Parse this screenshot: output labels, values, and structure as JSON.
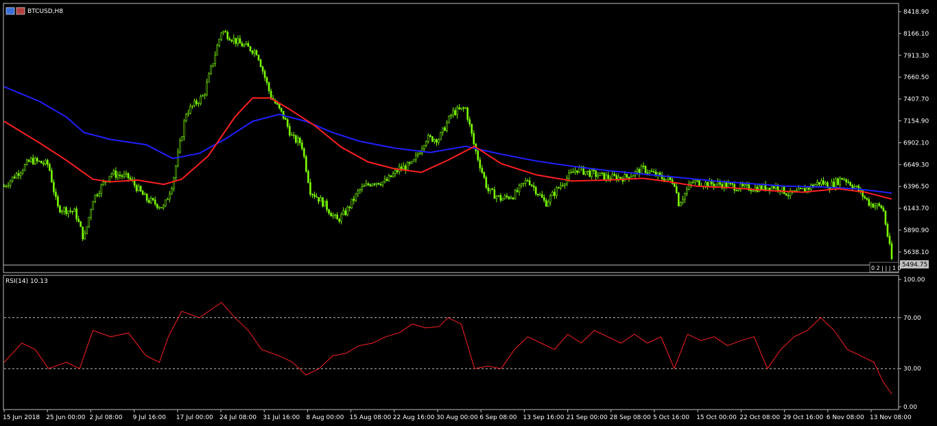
{
  "chart_data": [
    {
      "type": "candlestick",
      "title": "BTCUSD,H8",
      "symbol": "BTCUSD",
      "timeframe": "H8",
      "ylim": [
        5494.75,
        8418.9
      ],
      "y_ticks": [
        "8418.90",
        "8166.10",
        "7913.30",
        "7660.50",
        "7407.70",
        "7154.90",
        "6902.10",
        "6649.30",
        "6396.50",
        "6143.70",
        "5890.90",
        "5638.10"
      ],
      "current_price": "5494.75",
      "grid": false,
      "colors": {
        "background": "#000000",
        "candle": "#7CFC00",
        "ma_fast": "#ff2020",
        "ma_slow": "#2020ff",
        "axis": "#c0c0c0"
      },
      "x_tick_labels": [
        "15 Jun 2018",
        "25 Jun 00:00",
        "2 Jul 08:00",
        "9 Jul 16:00",
        "17 Jul 00:00",
        "24 Jul 08:00",
        "31 Jul 16:00",
        "8 Aug 00:00",
        "15 Aug 08:00",
        "22 Aug 16:00",
        "30 Aug 00:00",
        "6 Sep 08:00",
        "13 Sep 16:00",
        "21 Sep 00:00",
        "28 Sep 08:00",
        "5 Oct 16:00",
        "15 Oct 00:00",
        "22 Oct 08:00",
        "29 Oct 16:00",
        "6 Nov 08:00",
        "13 Nov 08:00"
      ],
      "close_path": [
        [
          0,
          6400
        ],
        [
          0.03,
          6700
        ],
        [
          0.05,
          6650
        ],
        [
          0.06,
          6150
        ],
        [
          0.08,
          6100
        ],
        [
          0.09,
          5780
        ],
        [
          0.1,
          6250
        ],
        [
          0.12,
          6550
        ],
        [
          0.14,
          6500
        ],
        [
          0.16,
          6250
        ],
        [
          0.18,
          6150
        ],
        [
          0.19,
          6450
        ],
        [
          0.205,
          7250
        ],
        [
          0.225,
          7450
        ],
        [
          0.245,
          8200
        ],
        [
          0.265,
          8050
        ],
        [
          0.285,
          7950
        ],
        [
          0.3,
          7450
        ],
        [
          0.315,
          7200
        ],
        [
          0.325,
          6950
        ],
        [
          0.335,
          6900
        ],
        [
          0.345,
          6350
        ],
        [
          0.36,
          6200
        ],
        [
          0.375,
          6000
        ],
        [
          0.385,
          6100
        ],
        [
          0.4,
          6350
        ],
        [
          0.415,
          6450
        ],
        [
          0.43,
          6450
        ],
        [
          0.445,
          6600
        ],
        [
          0.46,
          6650
        ],
        [
          0.475,
          6950
        ],
        [
          0.49,
          6950
        ],
        [
          0.505,
          7250
        ],
        [
          0.52,
          7300
        ],
        [
          0.53,
          6850
        ],
        [
          0.545,
          6350
        ],
        [
          0.56,
          6250
        ],
        [
          0.575,
          6300
        ],
        [
          0.59,
          6480
        ],
        [
          0.61,
          6200
        ],
        [
          0.63,
          6450
        ],
        [
          0.645,
          6600
        ],
        [
          0.66,
          6550
        ],
        [
          0.68,
          6500
        ],
        [
          0.7,
          6500
        ],
        [
          0.72,
          6600
        ],
        [
          0.74,
          6500
        ],
        [
          0.755,
          6450
        ],
        [
          0.76,
          6200
        ],
        [
          0.775,
          6450
        ],
        [
          0.79,
          6430
        ],
        [
          0.81,
          6420
        ],
        [
          0.83,
          6380
        ],
        [
          0.85,
          6380
        ],
        [
          0.87,
          6400
        ],
        [
          0.885,
          6300
        ],
        [
          0.9,
          6350
        ],
        [
          0.92,
          6450
        ],
        [
          0.93,
          6400
        ],
        [
          0.945,
          6500
        ],
        [
          0.96,
          6380
        ],
        [
          0.975,
          6200
        ],
        [
          0.99,
          6150
        ],
        [
          1.0,
          5550
        ]
      ],
      "ma_fast": [
        [
          0,
          7150
        ],
        [
          0.04,
          6900
        ],
        [
          0.07,
          6700
        ],
        [
          0.1,
          6480
        ],
        [
          0.12,
          6450
        ],
        [
          0.15,
          6470
        ],
        [
          0.18,
          6420
        ],
        [
          0.2,
          6480
        ],
        [
          0.23,
          6750
        ],
        [
          0.26,
          7200
        ],
        [
          0.28,
          7420
        ],
        [
          0.3,
          7420
        ],
        [
          0.32,
          7300
        ],
        [
          0.35,
          7100
        ],
        [
          0.38,
          6850
        ],
        [
          0.41,
          6680
        ],
        [
          0.44,
          6600
        ],
        [
          0.47,
          6560
        ],
        [
          0.5,
          6700
        ],
        [
          0.53,
          6860
        ],
        [
          0.56,
          6660
        ],
        [
          0.6,
          6530
        ],
        [
          0.64,
          6460
        ],
        [
          0.68,
          6470
        ],
        [
          0.72,
          6490
        ],
        [
          0.75,
          6450
        ],
        [
          0.78,
          6400
        ],
        [
          0.82,
          6380
        ],
        [
          0.86,
          6350
        ],
        [
          0.9,
          6330
        ],
        [
          0.94,
          6370
        ],
        [
          0.97,
          6330
        ],
        [
          1.0,
          6250
        ]
      ],
      "ma_slow": [
        [
          0,
          7550
        ],
        [
          0.04,
          7380
        ],
        [
          0.07,
          7200
        ],
        [
          0.09,
          7020
        ],
        [
          0.12,
          6940
        ],
        [
          0.16,
          6880
        ],
        [
          0.19,
          6720
        ],
        [
          0.22,
          6780
        ],
        [
          0.25,
          6950
        ],
        [
          0.28,
          7150
        ],
        [
          0.31,
          7230
        ],
        [
          0.34,
          7150
        ],
        [
          0.37,
          7020
        ],
        [
          0.4,
          6920
        ],
        [
          0.44,
          6840
        ],
        [
          0.48,
          6790
        ],
        [
          0.52,
          6860
        ],
        [
          0.56,
          6770
        ],
        [
          0.6,
          6690
        ],
        [
          0.64,
          6630
        ],
        [
          0.68,
          6580
        ],
        [
          0.72,
          6540
        ],
        [
          0.76,
          6500
        ],
        [
          0.8,
          6460
        ],
        [
          0.84,
          6430
        ],
        [
          0.88,
          6400
        ],
        [
          0.92,
          6390
        ],
        [
          0.96,
          6370
        ],
        [
          1.0,
          6320
        ]
      ]
    },
    {
      "type": "line",
      "title": "RSI(14) 10.13",
      "ylim": [
        0,
        100
      ],
      "y_ticks": [
        "100.00",
        "70.00",
        "30.00",
        "0.00"
      ],
      "levels": [
        70,
        30
      ],
      "colors": {
        "line": "#ff2020",
        "level": "#c0c0c0"
      },
      "values": [
        [
          0,
          35
        ],
        [
          0.02,
          50
        ],
        [
          0.035,
          45
        ],
        [
          0.05,
          30
        ],
        [
          0.07,
          35
        ],
        [
          0.085,
          30
        ],
        [
          0.1,
          60
        ],
        [
          0.12,
          55
        ],
        [
          0.14,
          58
        ],
        [
          0.16,
          40
        ],
        [
          0.175,
          35
        ],
        [
          0.185,
          55
        ],
        [
          0.2,
          75
        ],
        [
          0.22,
          70
        ],
        [
          0.245,
          82
        ],
        [
          0.26,
          70
        ],
        [
          0.275,
          60
        ],
        [
          0.29,
          45
        ],
        [
          0.31,
          40
        ],
        [
          0.325,
          35
        ],
        [
          0.34,
          25
        ],
        [
          0.355,
          30
        ],
        [
          0.37,
          40
        ],
        [
          0.385,
          42
        ],
        [
          0.4,
          48
        ],
        [
          0.415,
          50
        ],
        [
          0.43,
          55
        ],
        [
          0.445,
          58
        ],
        [
          0.46,
          65
        ],
        [
          0.475,
          62
        ],
        [
          0.49,
          63
        ],
        [
          0.5,
          70
        ],
        [
          0.515,
          65
        ],
        [
          0.53,
          30
        ],
        [
          0.545,
          32
        ],
        [
          0.56,
          30
        ],
        [
          0.575,
          45
        ],
        [
          0.59,
          55
        ],
        [
          0.605,
          50
        ],
        [
          0.62,
          45
        ],
        [
          0.635,
          57
        ],
        [
          0.65,
          50
        ],
        [
          0.665,
          60
        ],
        [
          0.68,
          55
        ],
        [
          0.695,
          50
        ],
        [
          0.71,
          57
        ],
        [
          0.725,
          50
        ],
        [
          0.74,
          55
        ],
        [
          0.755,
          30
        ],
        [
          0.77,
          57
        ],
        [
          0.785,
          52
        ],
        [
          0.8,
          55
        ],
        [
          0.815,
          48
        ],
        [
          0.83,
          52
        ],
        [
          0.845,
          55
        ],
        [
          0.86,
          30
        ],
        [
          0.875,
          45
        ],
        [
          0.89,
          55
        ],
        [
          0.905,
          60
        ],
        [
          0.92,
          70
        ],
        [
          0.935,
          60
        ],
        [
          0.95,
          45
        ],
        [
          0.965,
          40
        ],
        [
          0.98,
          35
        ],
        [
          0.99,
          20
        ],
        [
          1.0,
          10
        ]
      ]
    }
  ],
  "ui": {
    "price_marker": "0 2 | | | 1 0"
  }
}
